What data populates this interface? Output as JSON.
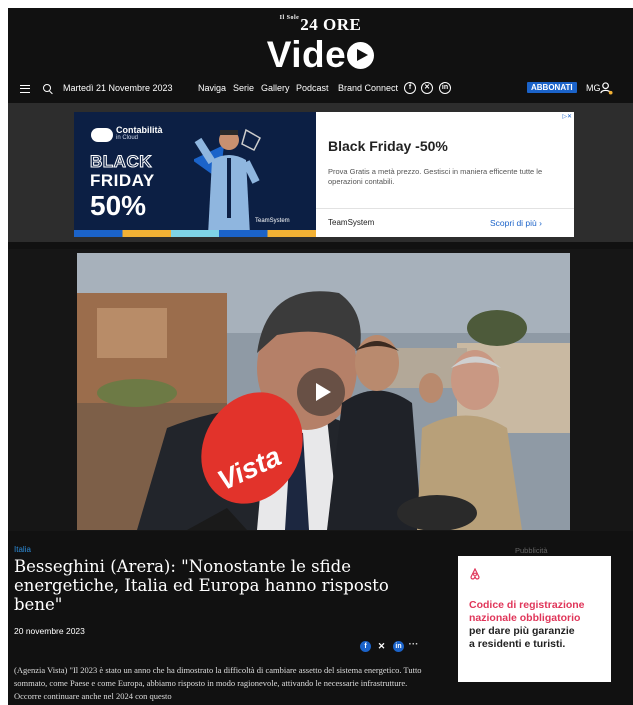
{
  "header": {
    "logo_small": "24 ORE",
    "logo_small_prefix": "Il Sole",
    "logo_video": "Vide",
    "nav": {
      "date": "Martedì 21 Novembre 2023",
      "items": [
        "Naviga",
        "Serie",
        "Gallery",
        "Podcast",
        "Brand Connect"
      ],
      "abbonati": "ABBONATI",
      "user_initials": "MG"
    }
  },
  "ad_banner": {
    "brand": "Contabilità",
    "brand_sub": "in Cloud",
    "black": "BLACK",
    "friday": "FRIDAY",
    "percent": "50%",
    "teamsystem_logo": "TeamSystem",
    "title": "Black Friday -50%",
    "description": "Prova Gratis a metà prezzo. Gestisci in maniera efficente tutte le operazioni contabili.",
    "company": "TeamSystem",
    "cta": "Scopri di più"
  },
  "video": {
    "mic_brand": "Vista"
  },
  "article": {
    "category": "Italia",
    "title": "Besseghini (Arera): \"Nonostante le sfide energetiche, Italia ed Europa hanno risposto bene\"",
    "date": "20 novembre 2023",
    "more": "···",
    "body": "(Agenzia Vista) \"Il 2023 è stato un anno che ha dimostrato la difficoltà di cambiare assetto del sistema energetico. Tutto sommato, come Paese e come Europa, abbiamo risposto in modo ragionevole, attivando le necessarie infrastrutture. Occorre continuare anche nel 2024 con questo"
  },
  "side_ad": {
    "label": "Pubblicità",
    "line1": "Codice di registrazione",
    "line2": "nazionale obbligatorio",
    "line3": "per dare più garanzie",
    "line4": "a residenti e turisti."
  },
  "colors": {
    "background": "#111111",
    "accent_blue": "#1b63c9",
    "category_blue": "#2e8bd6",
    "airbnb_red": "#e0365a"
  }
}
